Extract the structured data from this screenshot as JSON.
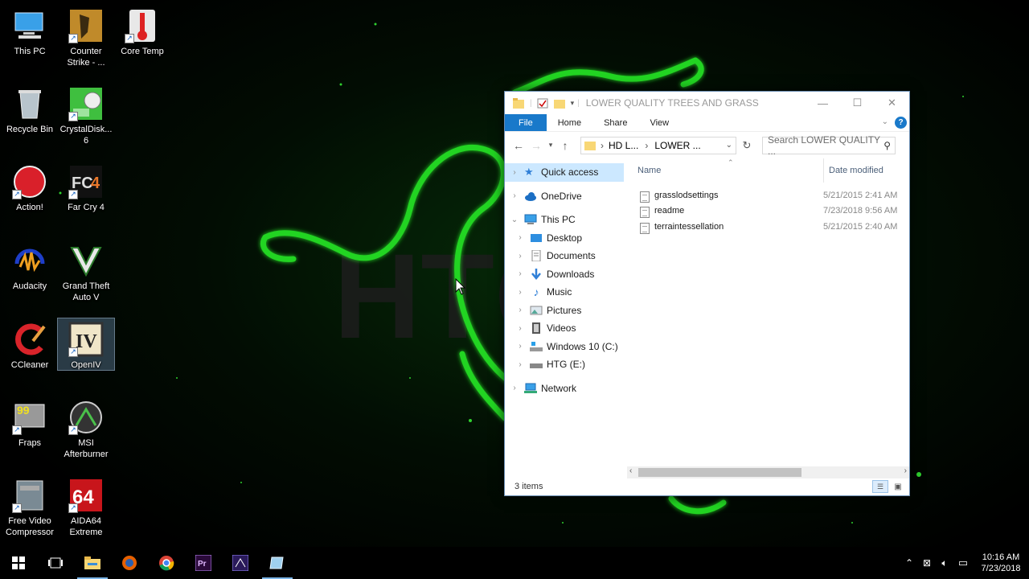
{
  "desktop": {
    "icons": [
      {
        "label": "This PC"
      },
      {
        "label": "Counter\nStrike - ..."
      },
      {
        "label": "Core Temp"
      },
      {
        "label": "Recycle Bin"
      },
      {
        "label": "CrystalDisk...\n6"
      },
      {
        "label": "Action!"
      },
      {
        "label": "Far Cry 4"
      },
      {
        "label": "Audacity"
      },
      {
        "label": "Grand Theft\nAuto V"
      },
      {
        "label": "CCleaner"
      },
      {
        "label": "OpenIV"
      },
      {
        "label": "Fraps"
      },
      {
        "label": "MSI\nAfterburner"
      },
      {
        "label": "Free Video\nCompressor"
      },
      {
        "label": "AIDA64\nExtreme"
      }
    ]
  },
  "explorer": {
    "title": "LOWER QUALITY TREES AND GRASS",
    "ribbon_tabs": [
      "File",
      "Home",
      "Share",
      "View"
    ],
    "breadcrumb": [
      "HD L...",
      "LOWER ..."
    ],
    "search_placeholder": "Search LOWER QUALITY ...",
    "nav": {
      "quick_access": "Quick access",
      "onedrive": "OneDrive",
      "this_pc": "This PC",
      "desktop": "Desktop",
      "documents": "Documents",
      "downloads": "Downloads",
      "music": "Music",
      "pictures": "Pictures",
      "videos": "Videos",
      "drive_c": "Windows 10 (C:)",
      "drive_e": "HTG (E:)",
      "network": "Network"
    },
    "columns": {
      "name": "Name",
      "date": "Date modified"
    },
    "files": [
      {
        "name": "grasslodsettings",
        "date": "5/21/2015 2:41 AM"
      },
      {
        "name": "readme",
        "date": "7/23/2018 9:56 AM"
      },
      {
        "name": "terraintessellation",
        "date": "5/21/2015 2:40 AM"
      }
    ],
    "status": "3 items"
  },
  "taskbar": {
    "time": "10:16 AM",
    "date": "7/23/2018"
  },
  "colors": {
    "accent": "#1979ca",
    "glow_green": "#2fd12f"
  }
}
